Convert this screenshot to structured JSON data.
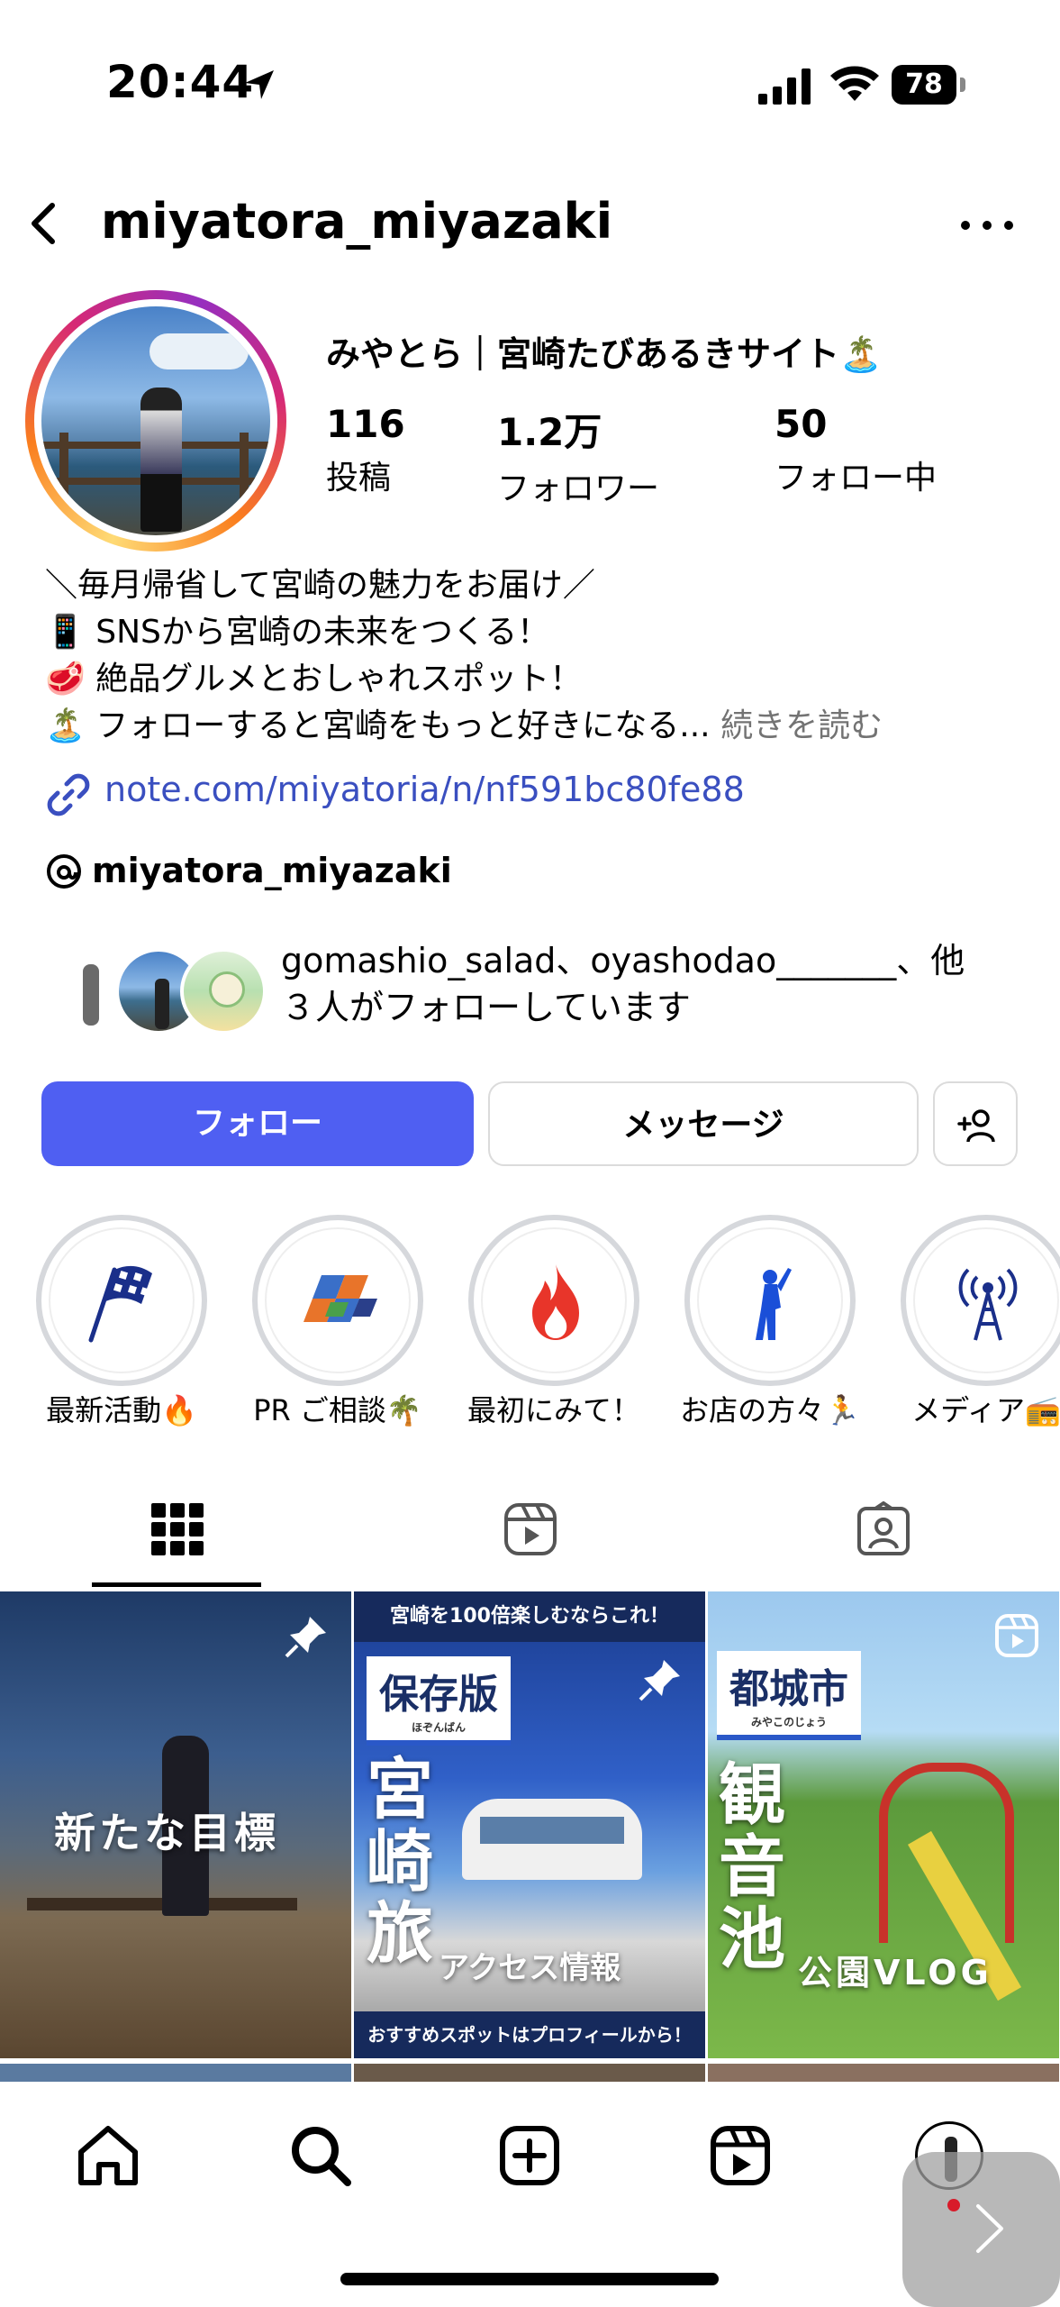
{
  "status": {
    "time": "20:44",
    "battery": "78"
  },
  "header": {
    "username": "miyatora_miyazaki"
  },
  "profile": {
    "display_name": "みやとら｜宮崎たびあるきサイト🏝️",
    "stats": [
      {
        "value": "116",
        "label": "投稿"
      },
      {
        "value": "1.2万",
        "label": "フォロワー"
      },
      {
        "value": "50",
        "label": "フォロー中"
      }
    ],
    "bio": [
      "＼毎月帰省して宮崎の魅力をお届け／",
      "📱 SNSから宮崎の未来をつくる！",
      "🥩 絶品グルメとおしゃれスポット！",
      "🏝️ フォローすると宮崎をもっと好きになる..."
    ],
    "bio_more": "続きを読む",
    "link": "note.com/miyatoria/n/nf591bc80fe88",
    "threads_handle": "miyatora_miyazaki",
    "followed_by_line1": "gomashio_salad、oyashodao_______、他",
    "followed_by_line2": "３人がフォローしています"
  },
  "actions": {
    "follow": "フォロー",
    "message": "メッセージ"
  },
  "highlights": [
    {
      "label": "最新活動🔥",
      "icon": "checkered-flag-icon"
    },
    {
      "label": "PR ご相談🌴",
      "icon": "tiles-logo-icon"
    },
    {
      "label": "最初にみて！",
      "icon": "fire-icon"
    },
    {
      "label": "お店の方々🏃",
      "icon": "person-pointing-icon"
    },
    {
      "label": "メディア📻",
      "icon": "antenna-icon"
    }
  ],
  "posts": [
    {
      "caption": "新たな目標",
      "pinned": true
    },
    {
      "top_banner": "宮崎を100倍楽しむならこれ！",
      "label": "保存版",
      "label_sub": "ほぞんばん",
      "big": "宮崎旅",
      "sub": "アクセス情報",
      "bottom_banner": "おすすめスポットはプロフィールから！",
      "pinned": true
    },
    {
      "label": "都城市",
      "label_sub": "みやこのじょう",
      "big": "観音池",
      "sub": "公園VLOG",
      "is_reel": true
    }
  ],
  "colors": {
    "accent": "#4f5ff2",
    "link": "#3a4fc0",
    "muted": "#737373"
  }
}
